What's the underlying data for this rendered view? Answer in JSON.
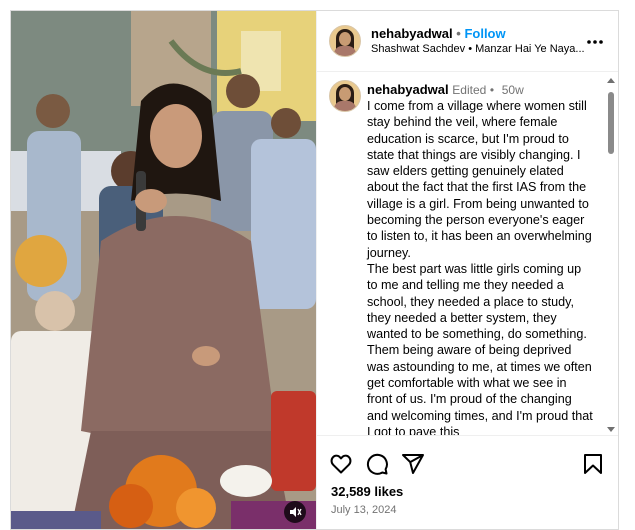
{
  "header": {
    "username": "nehabyadwal",
    "separator": "•",
    "follow_label": "Follow",
    "audio": "Shashwat Sachdev • Manzar Hai Ye Naya..."
  },
  "caption": {
    "username": "nehabyadwal",
    "edited": "Edited",
    "separator": "•",
    "age": "50w",
    "text": "I come from a village where women still stay behind the veil, where female education is scarce, but I'm proud to state that things are visibly changing. I saw elders getting genuinely elated about the fact that the first IAS from the village is a girl. From being unwanted to becoming the person everyone's eager to listen to, it has been an overwhelming journey.\nThe best part was little girls coming up to me and telling me they needed a school, they needed a place to study, they needed a better system, they wanted to be something, do something. Them being aware of being deprived was astounding to me, at times we often get comfortable with what we see in front of us. I'm proud of the changing and welcoming times, and I'm proud that I got to pave this"
  },
  "footer": {
    "likes": "32,589 likes",
    "date": "July 13, 2024"
  },
  "icons": {
    "like": "heart-icon",
    "comment": "comment-icon",
    "share": "share-icon",
    "save": "bookmark-icon",
    "more": "more-icon",
    "mute": "mute-icon"
  },
  "colors": {
    "link": "#0095f6",
    "muted": "#737373",
    "border": "#dbdbdb"
  }
}
